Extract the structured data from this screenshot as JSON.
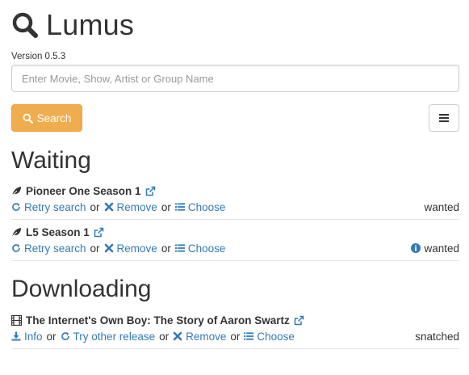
{
  "app": {
    "title": "Lumus",
    "version": "Version 0.5.3"
  },
  "search": {
    "placeholder": "Enter Movie, Show, Artist or Group Name",
    "value": "",
    "button_label": "Search"
  },
  "colors": {
    "accent_orange": "#f0ad4e",
    "link_blue": "#337ab7",
    "text": "#333333"
  },
  "sections": {
    "waiting": {
      "heading": "Waiting",
      "items": [
        {
          "title": "Pioneer One Season 1",
          "type_icon": "leaf-icon",
          "actions": {
            "retry": "Retry search",
            "remove": "Remove",
            "choose": "Choose",
            "or": "or"
          },
          "status": "wanted"
        },
        {
          "title": "L5 Season 1",
          "type_icon": "leaf-icon",
          "actions": {
            "retry": "Retry search",
            "remove": "Remove",
            "choose": "Choose",
            "or": "or"
          },
          "status": "wanted",
          "status_icon": "info-circle-icon"
        }
      ]
    },
    "downloading": {
      "heading": "Downloading",
      "items": [
        {
          "title": "The Internet's Own Boy: The Story of Aaron Swartz",
          "type_icon": "film-icon",
          "actions": {
            "info": "Info",
            "retry": "Try other release",
            "remove": "Remove",
            "choose": "Choose",
            "or": "or"
          },
          "status": "snatched"
        }
      ]
    }
  }
}
